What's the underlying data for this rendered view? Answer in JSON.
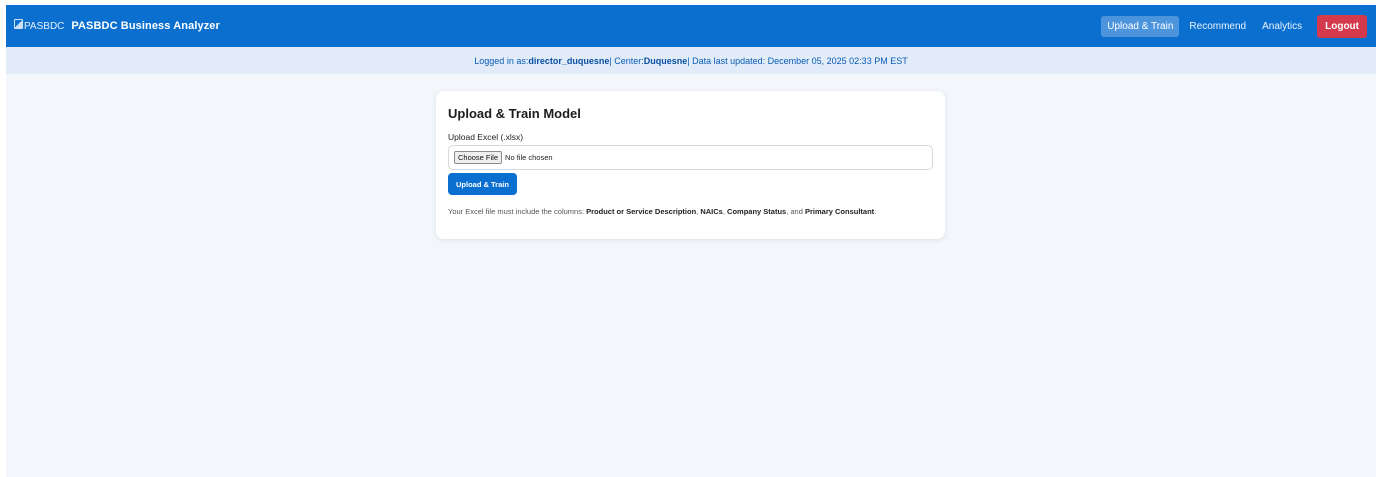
{
  "brand": {
    "logo_alt": "PASBDC",
    "title": "PASBDC Business Analyzer"
  },
  "nav": {
    "items": [
      {
        "label": "Upload & Train",
        "active": true
      },
      {
        "label": "Recommend",
        "active": false
      },
      {
        "label": "Analytics",
        "active": false
      }
    ],
    "logout_label": "Logout"
  },
  "info": {
    "logged_prefix": "Logged in as: ",
    "username": "director_duquesne",
    "center_prefix": " | Center: ",
    "center": "Duquesne",
    "updated_text": " | Data last updated: December 05, 2025 02:33 PM EST"
  },
  "card": {
    "title": "Upload & Train Model",
    "field_label": "Upload Excel (.xlsx)",
    "choose_file_label": "Choose File",
    "no_file_text": "No file chosen",
    "submit_label": "Upload & Train",
    "help": {
      "prefix": "Your Excel file must include the columns: ",
      "col1": "Product or Service Description",
      "sep1": ", ",
      "col2": "NAICs",
      "sep2": ", ",
      "col3": "Company Status",
      "sep3": ", and ",
      "col4": "Primary Consultant",
      "suffix": "."
    }
  },
  "colors": {
    "primary": "#0b6fd0",
    "danger": "#d43a4b",
    "background": "#f3f7fb"
  }
}
